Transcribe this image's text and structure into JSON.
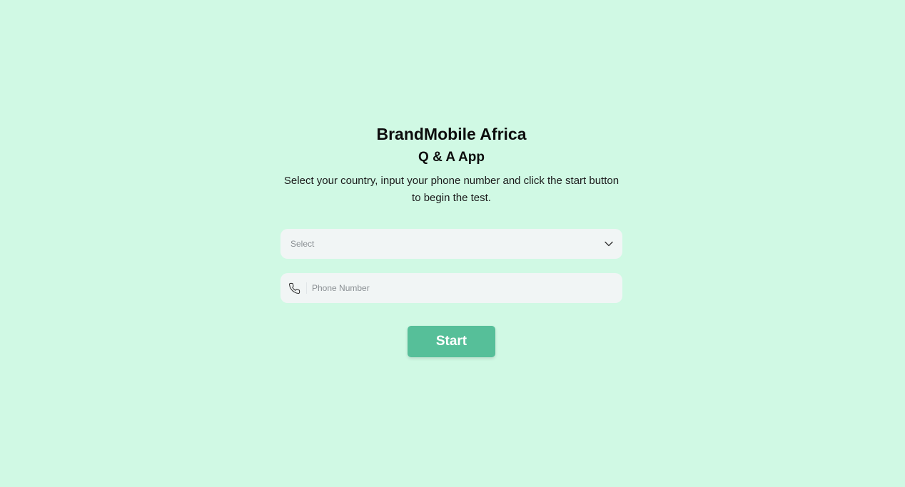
{
  "header": {
    "title": "BrandMobile Africa",
    "subtitle": "Q & A App",
    "instructions": "Select your country, input your phone number and click the start button to begin the test."
  },
  "form": {
    "country_select": {
      "value": "Select",
      "icon": "chevron-down-icon"
    },
    "phone": {
      "placeholder": "Phone Number",
      "value": "",
      "icon": "phone-icon"
    },
    "start_label": "Start"
  },
  "colors": {
    "background": "#d0f9e4",
    "field_background": "#f1f5f5",
    "accent": "#56bf99"
  }
}
